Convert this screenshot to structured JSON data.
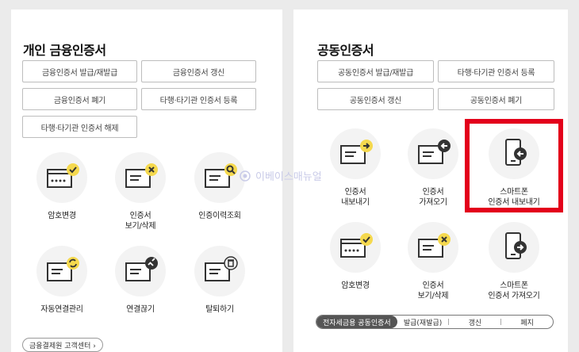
{
  "left": {
    "title": "개인 금융인증서",
    "buttons": [
      "금융인증서 발급/재발급",
      "금융인증서 갱신",
      "금융인증서 폐기",
      "타행·타기관 인증서 등록",
      "타행·타기관 인증서 해제"
    ],
    "tiles": [
      "암호변경",
      "인증서\n보기/삭제",
      "인증이력조회",
      "자동연결관리",
      "연결끊기",
      "탈퇴하기"
    ],
    "footer_link": "금융결제원 고객센터 ›"
  },
  "right": {
    "title": "공동인증서",
    "buttons": [
      "공동인증서 발급/재발급",
      "타행·타기관 인증서 등록",
      "공동인증서 갱신",
      "공동인증서 폐기"
    ],
    "tiles": [
      "인증서\n내보내기",
      "인증서\n가져오기",
      "스마트폰\n인증서 내보내기",
      "암호변경",
      "인증서\n보기/삭제",
      "스마트폰\n인증서 가져오기"
    ],
    "bottom_bar": {
      "tag": "전자세금용 공동인증서",
      "options": [
        "발급(재발급)",
        "갱신",
        "폐지"
      ]
    }
  },
  "watermark": "이베이스매뉴얼",
  "colors": {
    "accent_yellow": "#f5d94e",
    "highlight_red": "#e3001b"
  }
}
